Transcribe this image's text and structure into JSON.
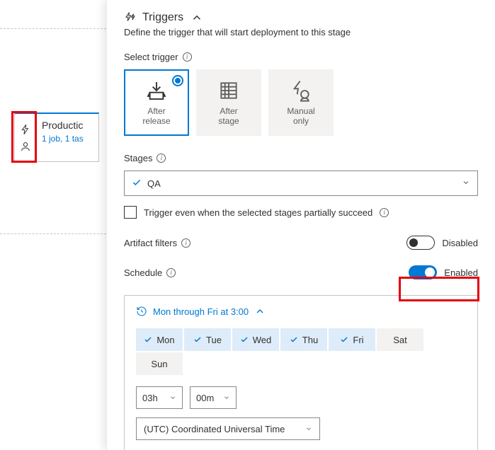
{
  "pipeline": {
    "stage_name": "Productic",
    "stage_sub": "1 job, 1 tas"
  },
  "panel": {
    "title": "Triggers",
    "subtitle": "Define the trigger that will start deployment to this stage"
  },
  "select_trigger": {
    "label": "Select trigger",
    "options": [
      {
        "key": "after-release",
        "label": "After\nrelease",
        "selected": true
      },
      {
        "key": "after-stage",
        "label": "After\nstage",
        "selected": false
      },
      {
        "key": "manual-only",
        "label": "Manual\nonly",
        "selected": false
      }
    ]
  },
  "stages": {
    "label": "Stages",
    "value": "QA"
  },
  "partial_succeed": {
    "label": "Trigger even when the selected stages partially succeed",
    "checked": false
  },
  "artifact_filters": {
    "label": "Artifact filters",
    "enabled": false,
    "state_label": "Disabled"
  },
  "schedule": {
    "label": "Schedule",
    "enabled": true,
    "state_label": "Enabled",
    "summary": "Mon through Fri at 3:00",
    "days": [
      {
        "label": "Mon",
        "selected": true
      },
      {
        "label": "Tue",
        "selected": true
      },
      {
        "label": "Wed",
        "selected": true
      },
      {
        "label": "Thu",
        "selected": true
      },
      {
        "label": "Fri",
        "selected": true
      },
      {
        "label": "Sat",
        "selected": false
      },
      {
        "label": "Sun",
        "selected": false
      }
    ],
    "hour": "03h",
    "minute": "00m",
    "timezone": "(UTC) Coordinated Universal Time"
  }
}
